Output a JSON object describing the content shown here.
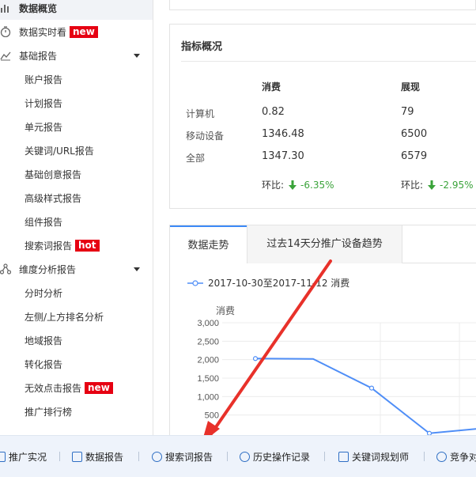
{
  "sidebar": {
    "items": [
      {
        "label": "数据概览",
        "type": "top",
        "active": true,
        "icon": "bar-chart-icon"
      },
      {
        "label": "数据实时看",
        "type": "top",
        "badge": "new",
        "icon": "stopwatch-icon"
      },
      {
        "label": "基础报告",
        "type": "top",
        "expandable": true,
        "icon": "line-chart-icon"
      },
      {
        "label": "账户报告",
        "type": "sub"
      },
      {
        "label": "计划报告",
        "type": "sub"
      },
      {
        "label": "单元报告",
        "type": "sub"
      },
      {
        "label": "关键词/URL报告",
        "type": "sub"
      },
      {
        "label": "基础创意报告",
        "type": "sub"
      },
      {
        "label": "高级样式报告",
        "type": "sub"
      },
      {
        "label": "组件报告",
        "type": "sub"
      },
      {
        "label": "搜索词报告",
        "type": "sub",
        "badge": "hot"
      },
      {
        "label": "维度分析报告",
        "type": "top",
        "expandable": true,
        "icon": "network-icon"
      },
      {
        "label": "分时分析",
        "type": "sub"
      },
      {
        "label": "左侧/上方排名分析",
        "type": "sub"
      },
      {
        "label": "地域报告",
        "type": "sub"
      },
      {
        "label": "转化报告",
        "type": "sub"
      },
      {
        "label": "无效点击报告",
        "type": "sub",
        "badge": "new"
      },
      {
        "label": "推广排行榜",
        "type": "sub"
      }
    ]
  },
  "metrics": {
    "title": "指标概况",
    "headers": [
      "消费",
      "展现"
    ],
    "rows": [
      {
        "label": "计算机",
        "values": [
          "0.82",
          "79"
        ]
      },
      {
        "label": "移动设备",
        "values": [
          "1346.48",
          "6500"
        ]
      },
      {
        "label": "全部",
        "values": [
          "1347.30",
          "6579"
        ]
      }
    ],
    "ratio_label": "环比:",
    "ratios": [
      "-6.35%",
      "-2.95%"
    ]
  },
  "trend": {
    "tabs": [
      "数据走势",
      "过去14天分推广设备趋势"
    ],
    "legend": "2017-10-30至2017-11-12 消费"
  },
  "chart_data": {
    "type": "line",
    "title": "",
    "ylabel": "消费",
    "ylim": [
      0,
      3000
    ],
    "yticks": [
      "3,000",
      "2,500",
      "2,000",
      "1,500",
      "1,000",
      "500"
    ],
    "series": [
      {
        "name": "2017-10-30至2017-11-12 消费",
        "values": [
          2030,
          2020,
          1230,
          5,
          150
        ]
      }
    ],
    "marker_points": [
      0,
      2,
      3
    ],
    "color": "#4f8ef7"
  },
  "bottombar": {
    "items": [
      {
        "label": "推广实况",
        "icon": "monitor-icon"
      },
      {
        "label": "数据报告",
        "icon": "bar-chart-icon"
      },
      {
        "label": "搜索词报告",
        "icon": "search-icon"
      },
      {
        "label": "历史操作记录",
        "icon": "clock-icon"
      },
      {
        "label": "关键词规划师",
        "icon": "word-icon"
      },
      {
        "label": "竞争对",
        "icon": "eye-icon"
      }
    ]
  },
  "colors": {
    "accent": "#3d8af7",
    "badge": "#e60012",
    "positive": "#3aa33a",
    "annotation_arrow": "#e8312a"
  }
}
